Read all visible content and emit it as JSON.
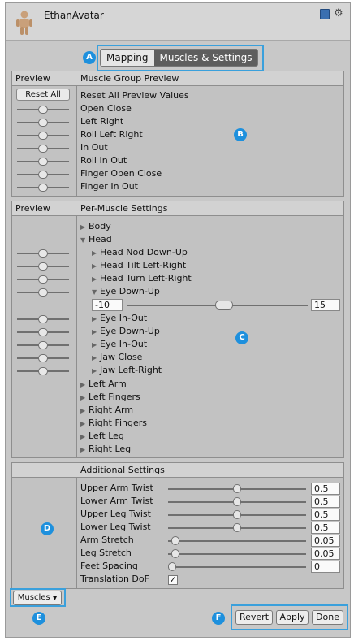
{
  "header": {
    "title": "EthanAvatar",
    "book_icon": "help-book-icon",
    "gear_icon": "gear-icon"
  },
  "tabs": [
    {
      "label": "Mapping",
      "active": false
    },
    {
      "label": "Muscles & Settings",
      "active": true
    }
  ],
  "badges": {
    "a": "A",
    "b": "B",
    "c": "C",
    "d": "D",
    "e": "E",
    "f": "F"
  },
  "muscle_group_preview": {
    "col_preview": "Preview",
    "col_title": "Muscle Group Preview",
    "reset_button": "Reset All",
    "items": [
      "Reset All Preview Values",
      "Open Close",
      "Left Right",
      "Roll Left Right",
      "In Out",
      "Roll In Out",
      "Finger Open Close",
      "Finger In Out"
    ]
  },
  "per_muscle": {
    "col_preview": "Preview",
    "col_title": "Per-Muscle Settings",
    "items": [
      {
        "label": "Body",
        "expanded": false,
        "level": 0
      },
      {
        "label": "Head",
        "expanded": true,
        "level": 0
      },
      {
        "label": "Head Nod Down-Up",
        "expanded": false,
        "level": 1
      },
      {
        "label": "Head Tilt Left-Right",
        "expanded": false,
        "level": 1
      },
      {
        "label": "Head Turn Left-Right",
        "expanded": false,
        "level": 1
      },
      {
        "label": "Eye Down-Up",
        "expanded": true,
        "level": 1
      },
      {
        "label": "Eye In-Out",
        "expanded": false,
        "level": 1
      },
      {
        "label": "Eye Down-Up",
        "expanded": false,
        "level": 1
      },
      {
        "label": "Eye In-Out",
        "expanded": false,
        "level": 1
      },
      {
        "label": "Jaw Close",
        "expanded": false,
        "level": 1
      },
      {
        "label": "Jaw Left-Right",
        "expanded": false,
        "level": 1
      },
      {
        "label": "Left Arm",
        "expanded": false,
        "level": 0
      },
      {
        "label": "Left Fingers",
        "expanded": false,
        "level": 0
      },
      {
        "label": "Right Arm",
        "expanded": false,
        "level": 0
      },
      {
        "label": "Right Fingers",
        "expanded": false,
        "level": 0
      },
      {
        "label": "Left Leg",
        "expanded": false,
        "level": 0
      },
      {
        "label": "Right Leg",
        "expanded": false,
        "level": 0
      }
    ],
    "range": {
      "min": "-10",
      "max": "15"
    }
  },
  "additional": {
    "col_title": "Additional Settings",
    "items": [
      {
        "label": "Upper Arm Twist",
        "value": "0.5",
        "level": 0.5
      },
      {
        "label": "Lower Arm Twist",
        "value": "0.5",
        "level": 0.5
      },
      {
        "label": "Upper Leg Twist",
        "value": "0.5",
        "level": 0.5
      },
      {
        "label": "Lower Leg Twist",
        "value": "0.5",
        "level": 0.5
      },
      {
        "label": "Arm Stretch",
        "value": "0.05",
        "level": 0.05
      },
      {
        "label": "Leg Stretch",
        "value": "0.05",
        "level": 0.05
      },
      {
        "label": "Feet Spacing",
        "value": "0",
        "level": 0
      }
    ],
    "translation_dof": {
      "label": "Translation DoF",
      "checked": true
    }
  },
  "footer": {
    "muscles_dropdown": "Muscles",
    "revert": "Revert",
    "apply": "Apply",
    "done": "Done"
  },
  "colors": {
    "accent": "#3aa0dc",
    "badge": "#1e90dd"
  }
}
